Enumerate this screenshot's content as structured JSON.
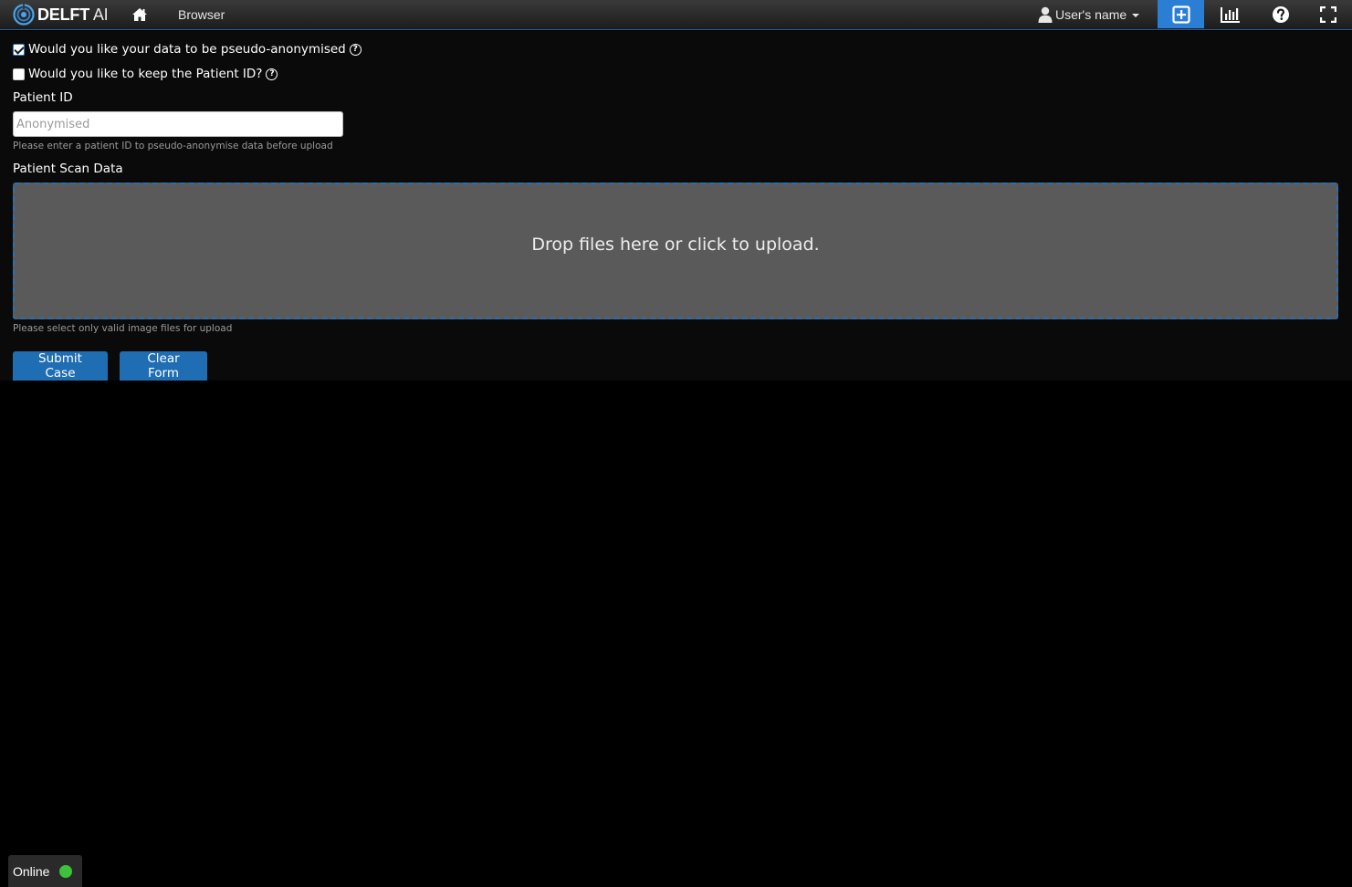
{
  "navbar": {
    "brand_bold": "DELFT",
    "brand_thin": "AI",
    "browser_label": "Browser",
    "user_label": "User's name",
    "add_active_color": "#2a7fd4"
  },
  "form": {
    "pseudo_anonymise": {
      "label": "Would you like your data to be pseudo-anonymised",
      "checked": true
    },
    "keep_patient_id": {
      "label": "Would you like to keep the Patient ID?",
      "checked": false
    },
    "patient_id": {
      "label": "Patient ID",
      "placeholder": "Anonymised",
      "value": "",
      "help": "Please enter a patient ID to pseudo-anonymise data before upload"
    },
    "scan_data": {
      "label": "Patient Scan Data",
      "dropzone_text": "Drop files here or click to upload.",
      "help": "Please select only valid image files for upload"
    },
    "submit_label": "Submit Case",
    "clear_label": "Clear Form"
  },
  "status": {
    "label": "Online",
    "color": "#3cc23c"
  }
}
